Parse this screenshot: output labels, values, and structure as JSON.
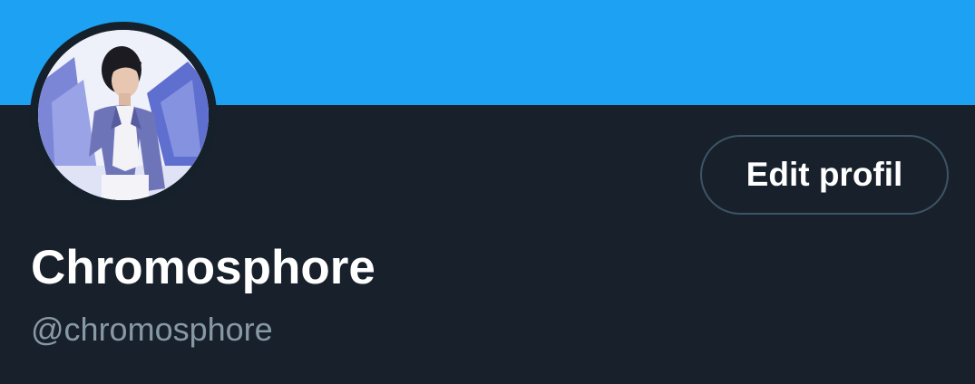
{
  "colors": {
    "banner": "#1da1f2",
    "background": "#18212b",
    "button_border": "#3d5466",
    "handle_text": "#8899a6"
  },
  "profile": {
    "display_name": "Chromosphore",
    "handle": "@chromosphore",
    "avatar_icon": "profile-photo"
  },
  "actions": {
    "edit_profile_label": "Edit profil"
  }
}
